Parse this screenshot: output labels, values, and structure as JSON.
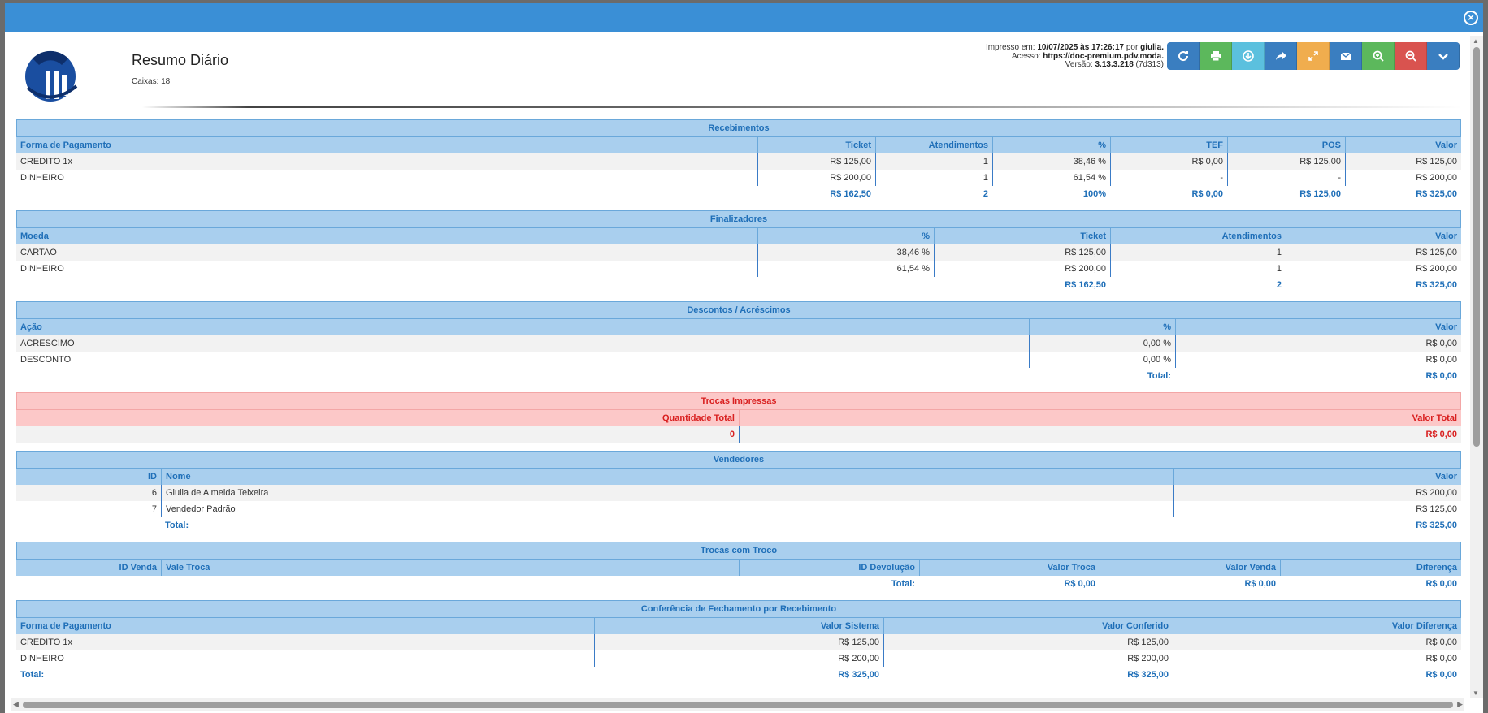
{
  "header": {
    "title": "Resumo Diário",
    "caixas": "Caixas: 18",
    "print_label": "Impresso em:",
    "print_datetime": "10/07/2025 às 17:26:17",
    "print_by": "por",
    "print_user": "giulia.",
    "access_label": "Acesso:",
    "access_url": "https://doc-premium.pdv.moda.",
    "version_label": "Versão:",
    "version_value": "3.13.3.218",
    "version_build": "(7d313)"
  },
  "toolbar": [
    {
      "name": "refresh-icon",
      "color": "#3a7ec0"
    },
    {
      "name": "print-icon",
      "color": "#5cb85c"
    },
    {
      "name": "download-icon",
      "color": "#5bc0de"
    },
    {
      "name": "share-icon",
      "color": "#3a7ec0"
    },
    {
      "name": "fullscreen-icon",
      "color": "#f0ad4e"
    },
    {
      "name": "mail-icon",
      "color": "#3a7ec0"
    },
    {
      "name": "zoom-in-icon",
      "color": "#5cb85c"
    },
    {
      "name": "zoom-out-icon",
      "color": "#d9534f"
    },
    {
      "name": "chevron-down-icon",
      "color": "#3a7ec0"
    }
  ],
  "sections": [
    {
      "title": "Recebimentos",
      "cols": "912px 145px 144px 145px 144px 145px 143px",
      "align": [
        "l",
        "r",
        "r",
        "r",
        "r",
        "r",
        "r"
      ],
      "headers": [
        "Forma de Pagamento",
        "Ticket",
        "Atendimentos",
        "%",
        "TEF",
        "POS",
        "Valor"
      ],
      "rows": [
        [
          "CREDITO 1x",
          "R$ 125,00",
          "1",
          "38,46 %",
          "R$ 0,00",
          "R$ 125,00",
          "R$ 125,00"
        ],
        [
          "DINHEIRO",
          "R$ 200,00",
          "1",
          "61,54 %",
          "-",
          "-",
          "R$ 200,00"
        ]
      ],
      "total": [
        "",
        "R$ 162,50",
        "2",
        "100%",
        "R$ 0,00",
        "R$ 125,00",
        "R$ 325,00"
      ]
    },
    {
      "title": "Finalizadores",
      "cols": "912px 217px 217px 216px 216px",
      "align": [
        "l",
        "r",
        "r",
        "r",
        "r"
      ],
      "headers": [
        "Moeda",
        "%",
        "Ticket",
        "Atendimentos",
        "Valor"
      ],
      "rows": [
        [
          "CARTAO",
          "38,46 %",
          "R$ 125,00",
          "1",
          "R$ 125,00"
        ],
        [
          "DINHEIRO",
          "61,54 %",
          "R$ 200,00",
          "1",
          "R$ 200,00"
        ]
      ],
      "total": [
        "",
        "",
        "R$ 162,50",
        "2",
        "R$ 325,00"
      ]
    },
    {
      "title": "Descontos / Acréscimos",
      "cols": "1246px 180px 352px",
      "align": [
        "l",
        "r",
        "r"
      ],
      "headers": [
        "Ação",
        "%",
        "Valor"
      ],
      "rows": [
        [
          "ACRESCIMO",
          "0,00 %",
          "R$ 0,00"
        ],
        [
          "DESCONTO",
          "0,00 %",
          "R$ 0,00"
        ]
      ],
      "total": [
        "",
        "Total:",
        "R$ 0,00"
      ]
    },
    {
      "title": "Trocas Impressas",
      "red": true,
      "cols": "889px 889px",
      "align": [
        "r",
        "r"
      ],
      "headers": [
        "Quantidade Total",
        "Valor Total"
      ],
      "rows": [],
      "total": [
        "0",
        "R$ 0,00"
      ]
    },
    {
      "title": "Vendedores",
      "cols": "178px 1246px 354px",
      "align": [
        "r",
        "l",
        "r"
      ],
      "headers": [
        "ID",
        "Nome",
        "Valor"
      ],
      "rows": [
        [
          "6",
          "Giulia de Almeida Teixeira",
          "R$ 200,00"
        ],
        [
          "7",
          "Vendedor Padrão",
          "R$ 125,00"
        ]
      ],
      "total": [
        "",
        "Total:",
        "R$ 325,00"
      ]
    },
    {
      "title": "Trocas com Troco",
      "cols": "178px 711px 222px 222px 222px 223px",
      "align": [
        "r",
        "l",
        "r",
        "r",
        "r",
        "r"
      ],
      "headers": [
        "ID Venda",
        "Vale Troca",
        "ID Devolução",
        "Valor Troca",
        "Valor Venda",
        "Diferença"
      ],
      "rows": [],
      "total": [
        "",
        "",
        "Total:",
        "R$ 0,00",
        "R$ 0,00",
        "R$ 0,00"
      ]
    },
    {
      "title": "Conferência de Fechamento por Recebimento",
      "cols": "711px 356px 356px 355px",
      "align": [
        "l",
        "r",
        "r",
        "r"
      ],
      "headers": [
        "Forma de Pagamento",
        "Valor Sistema",
        "Valor Conferido",
        "Valor Diferença"
      ],
      "rows": [
        [
          "CREDITO 1x",
          "R$ 125,00",
          "R$ 125,00",
          "R$ 0,00"
        ],
        [
          "DINHEIRO",
          "R$ 200,00",
          "R$ 200,00",
          "R$ 0,00"
        ]
      ],
      "total": [
        "Total:",
        "R$ 325,00",
        "R$ 325,00",
        "R$ 0,00"
      ]
    }
  ]
}
